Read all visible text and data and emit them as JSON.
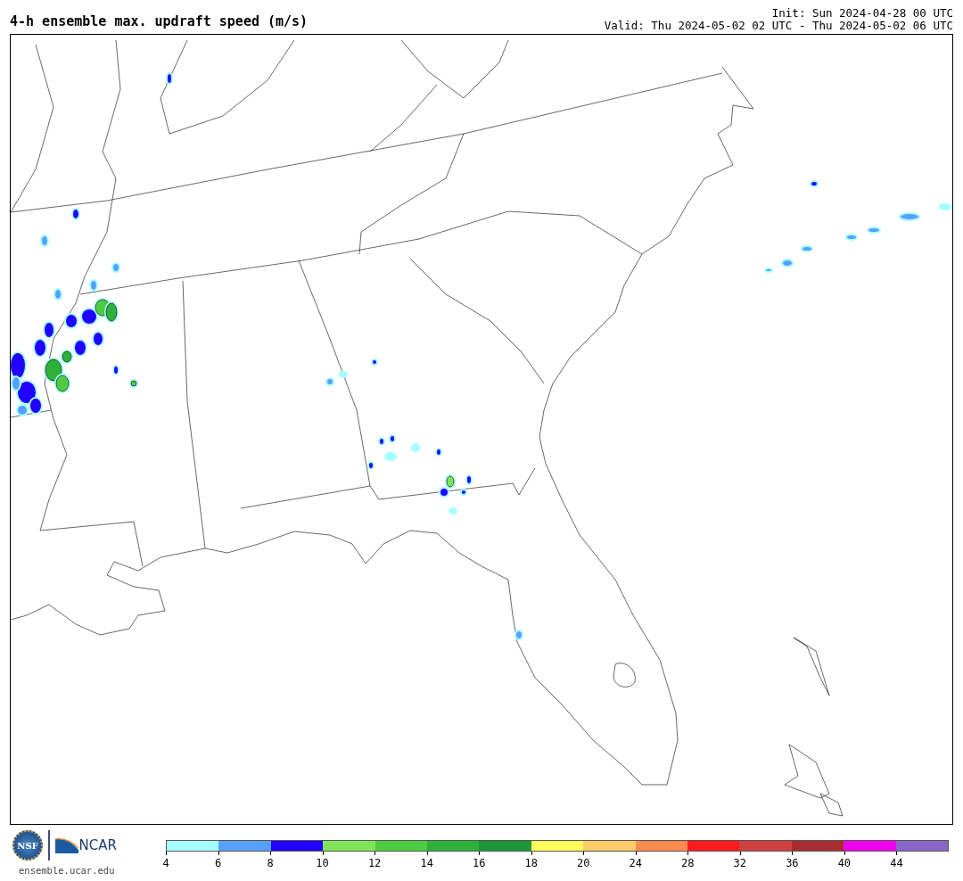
{
  "title": "4-h ensemble max. updraft speed (m/s)",
  "init": "Init: Sun 2024-04-28 00 UTC",
  "valid": "Valid: Thu 2024-05-02 02 UTC - Thu 2024-05-02 06 UTC",
  "logos": {
    "nsf": "NSF",
    "ncar": "NCAR",
    "site": "ensemble.ucar.edu"
  },
  "colorbar": {
    "segments": [
      {
        "color": "#a6ffff"
      },
      {
        "color": "#57a0ff"
      },
      {
        "color": "#2100ff"
      },
      {
        "color": "#80e55b"
      },
      {
        "color": "#4ecb42"
      },
      {
        "color": "#2fb03b"
      },
      {
        "color": "#20963a"
      },
      {
        "color": "#fffe5d"
      },
      {
        "color": "#ffcd69"
      },
      {
        "color": "#ff8a4f"
      },
      {
        "color": "#ff1b1c"
      },
      {
        "color": "#cf4040"
      },
      {
        "color": "#a62d2f"
      },
      {
        "color": "#ef00ef"
      },
      {
        "color": "#8a66cb"
      }
    ],
    "ticks": [
      "4",
      "6",
      "8",
      "10",
      "12",
      "14",
      "16",
      "18",
      "20",
      "24",
      "28",
      "32",
      "36",
      "40",
      "44"
    ]
  }
}
